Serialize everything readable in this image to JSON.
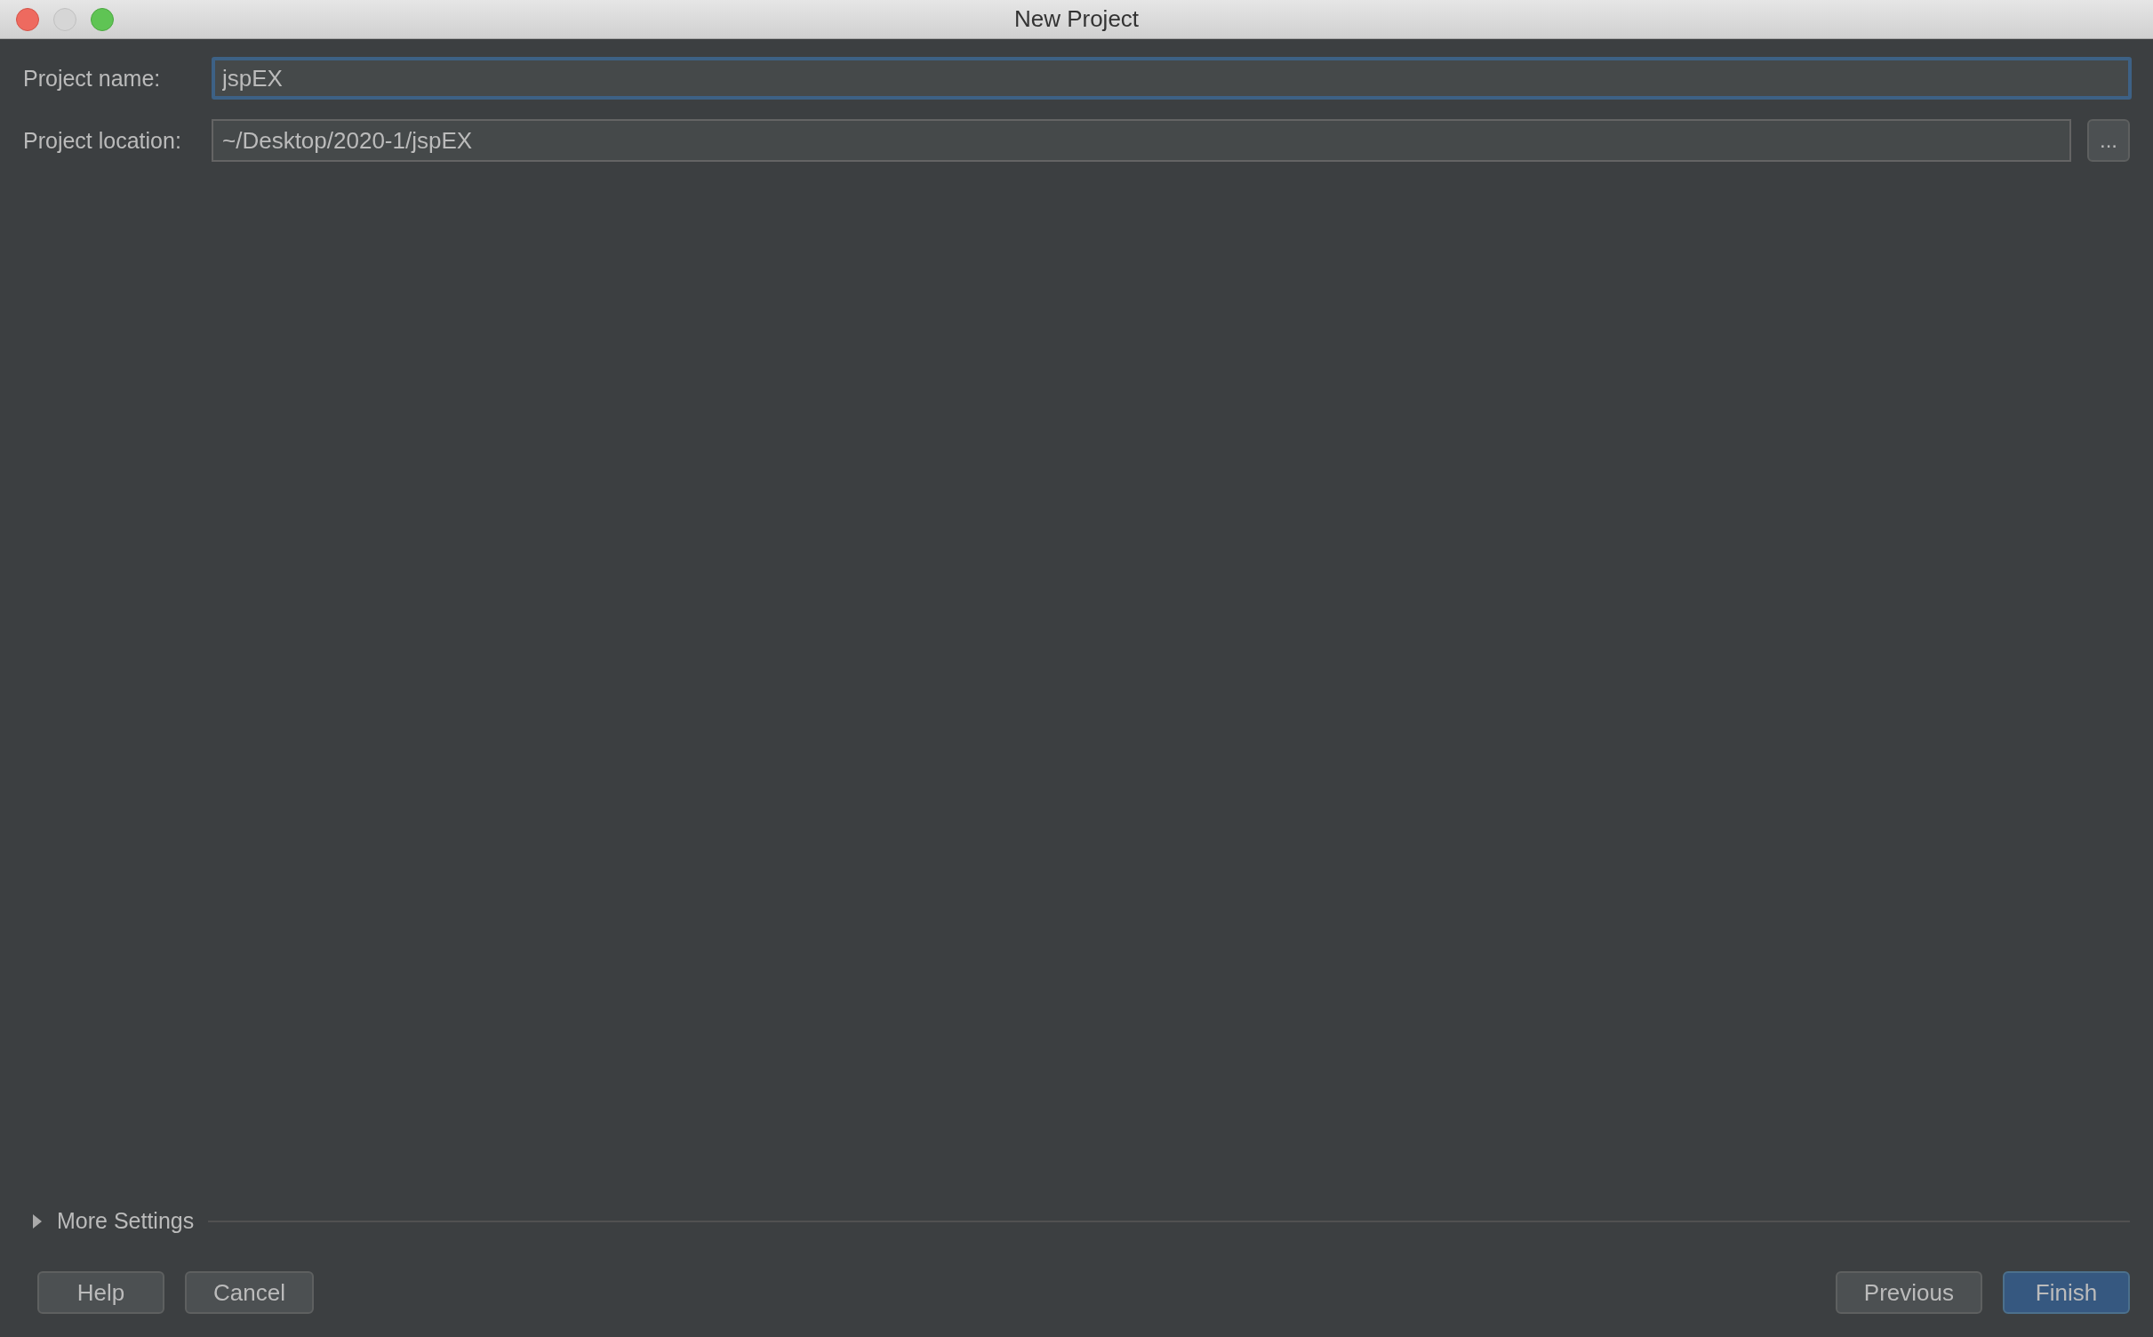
{
  "window": {
    "title": "New Project"
  },
  "fields": [
    {
      "label": "Project name:",
      "value": "jspEX",
      "focused": true
    },
    {
      "label": "Project location:",
      "value": "~/Desktop/2020-1/jspEX",
      "focused": false,
      "browse_button": "..."
    }
  ],
  "more_settings": {
    "label": "More Settings",
    "expanded": false
  },
  "buttons_left": [
    {
      "label": "Help",
      "default": false
    },
    {
      "label": "Cancel",
      "default": false
    }
  ],
  "buttons_right": [
    {
      "label": "Previous",
      "default": false
    },
    {
      "label": "Finish",
      "default": true
    }
  ]
}
